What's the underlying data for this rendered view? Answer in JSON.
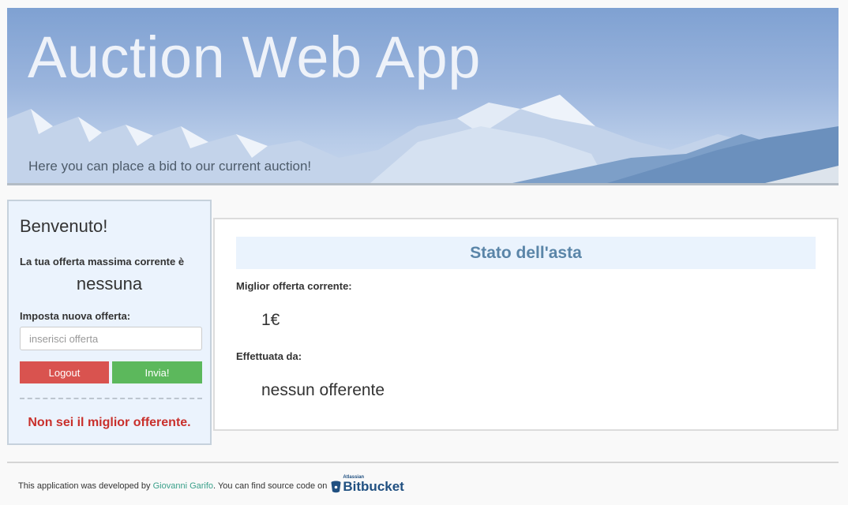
{
  "header": {
    "title": "Auction Web App",
    "subtitle": "Here you can place a bid to our current auction!"
  },
  "sidebar": {
    "welcome": "Benvenuto!",
    "current_max_label": "La tua offerta massima corrente è",
    "current_max_value": "nessuna",
    "new_offer_label": "Imposta nuova offerta:",
    "offer_input": {
      "value": "",
      "placeholder": "inserisci offerta"
    },
    "logout_label": "Logout",
    "send_label": "Invia!",
    "status_message": "Non sei il miglior offerente."
  },
  "auction_status": {
    "title": "Stato dell'asta",
    "best_offer_label": "Miglior offerta corrente:",
    "best_offer_value": "1€",
    "made_by_label": "Effettuata da:",
    "made_by_value": "nessun offerente"
  },
  "footer": {
    "text_before": "This application was developed by",
    "author": "Giovanni Garifo",
    "text_after": ". You can find source code on",
    "bitbucket_small": "Atlassian",
    "bitbucket_name": "Bitbucket"
  },
  "colors": {
    "banner_sky": "#7fa1d2",
    "logout_button": "#d9534f",
    "send_button": "#5cb85c",
    "status_message": "#c9302c",
    "status_title": "#5a85a8",
    "author_link": "#3aa08a",
    "bitbucket_brand": "#205081"
  },
  "icons": {
    "footer_logo": "bitbucket-logo-icon"
  }
}
